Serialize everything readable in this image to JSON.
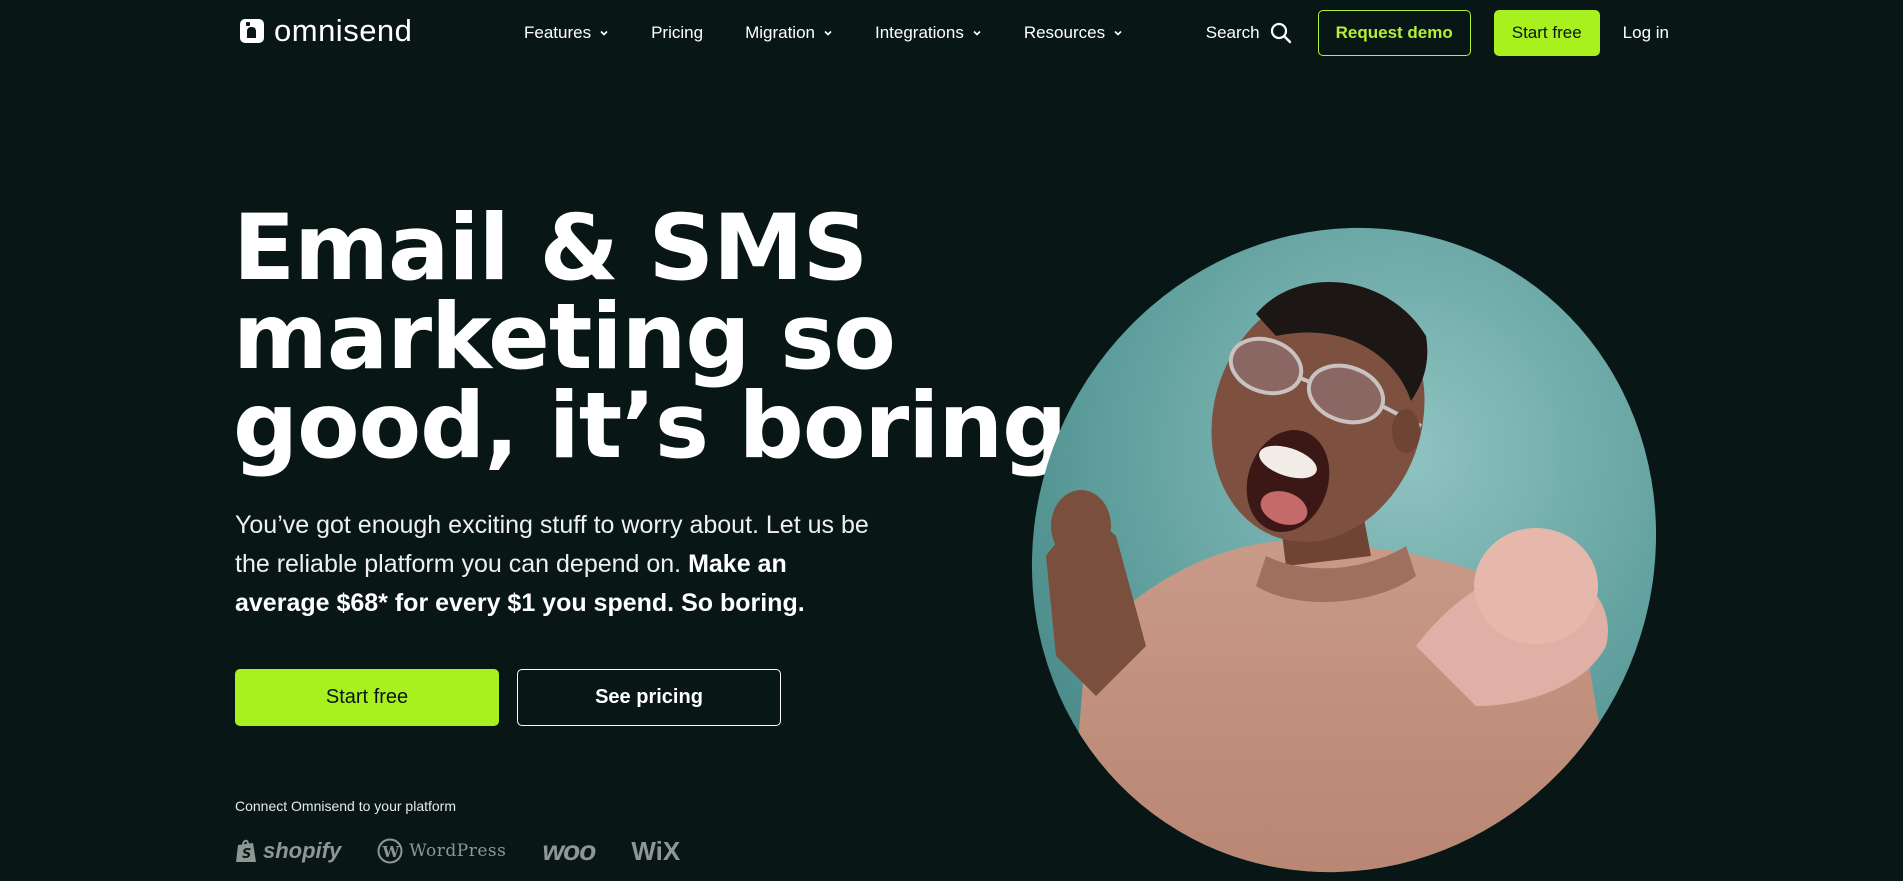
{
  "nav": {
    "logo_text": "omnisend",
    "links": [
      {
        "label": "Features",
        "has_dropdown": true
      },
      {
        "label": "Pricing",
        "has_dropdown": false
      },
      {
        "label": "Migration",
        "has_dropdown": true
      },
      {
        "label": "Integrations",
        "has_dropdown": true
      },
      {
        "label": "Resources",
        "has_dropdown": true
      }
    ],
    "search_label": "Search",
    "request_demo_label": "Request demo",
    "start_free_label": "Start free",
    "login_label": "Log in"
  },
  "hero": {
    "title_lines": [
      "Email & SMS",
      "marketing so",
      "good, it’s boring"
    ],
    "subtitle_plain": "You’ve got enough exciting stuff to worry about. Let us be the reliable platform you can depend on. ",
    "subtitle_bold": "Make an average $68* for every $1 you spend. So boring.",
    "start_free_label": "Start free",
    "see_pricing_label": "See pricing",
    "connect_label": "Connect Omnisend to your platform",
    "platforms": [
      "shopify",
      "WordPress",
      "woo",
      "WiX"
    ]
  },
  "colors": {
    "background": "#081716",
    "accent": "#a9f01f",
    "text": "#ffffff",
    "muted_logo": "#8f9795"
  }
}
